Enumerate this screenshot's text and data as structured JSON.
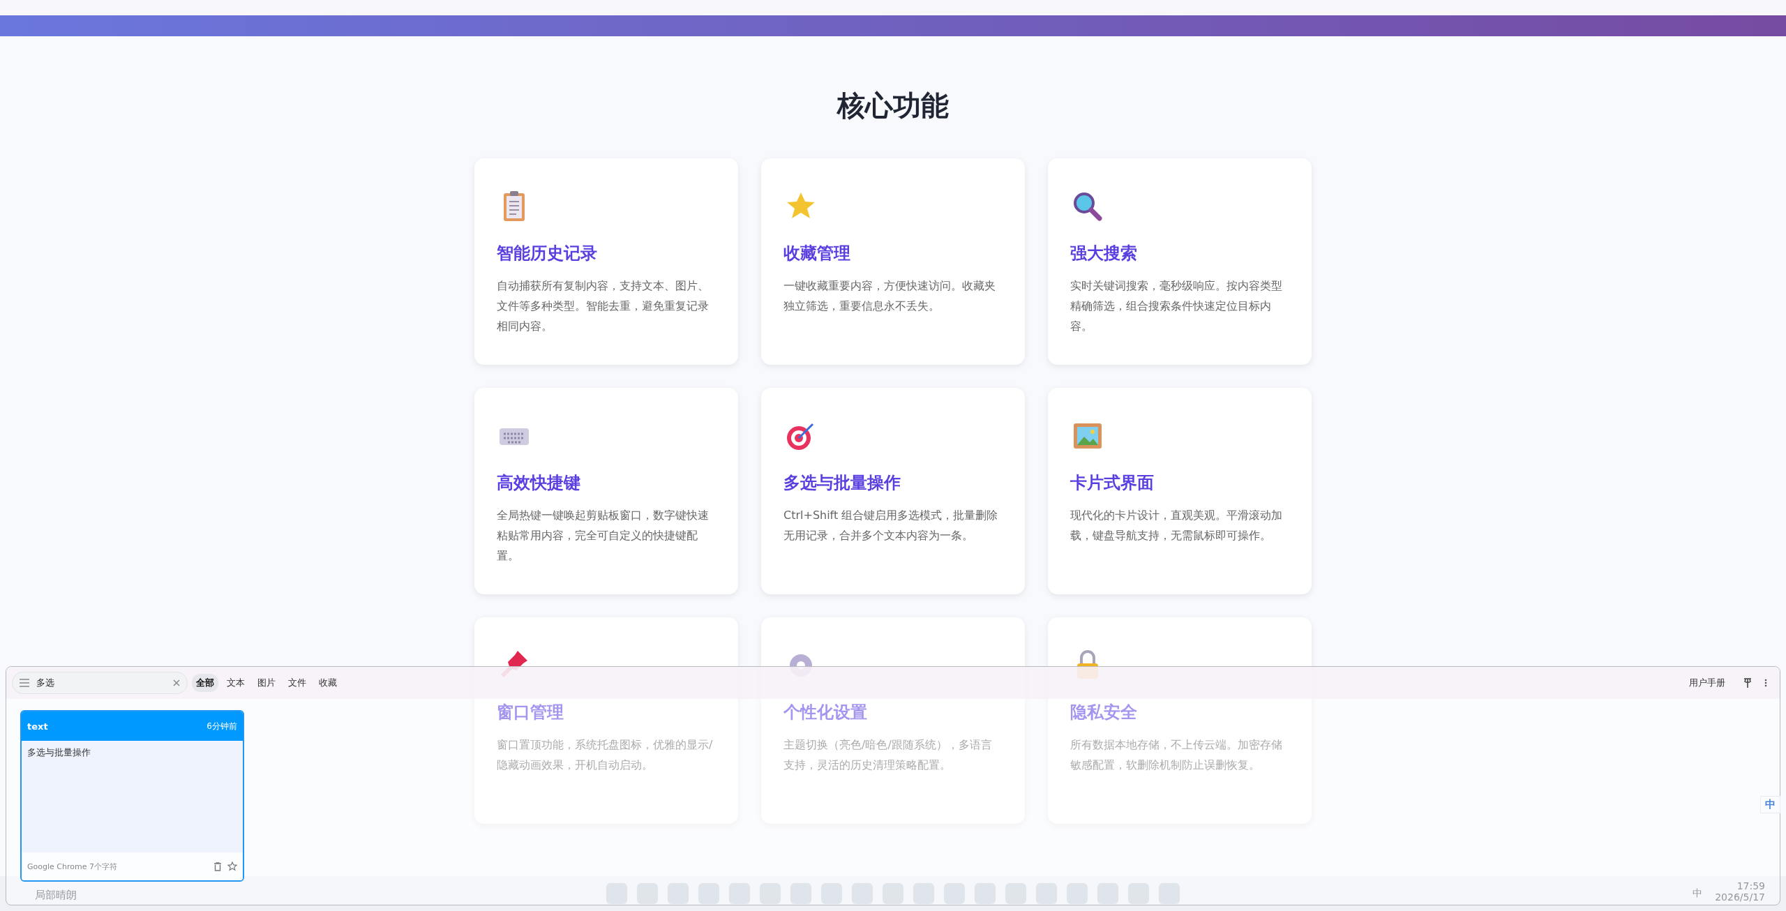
{
  "page": {
    "heading": "核心功能",
    "features": [
      {
        "title": "智能历史记录",
        "desc": "自动捕获所有复制内容，支持文本、图片、文件等多种类型。智能去重，避免重复记录相同内容。"
      },
      {
        "title": "收藏管理",
        "desc": "一键收藏重要内容，方便快速访问。收藏夹独立筛选，重要信息永不丢失。"
      },
      {
        "title": "强大搜索",
        "desc": "实时关键词搜索，毫秒级响应。按内容类型精确筛选，组合搜索条件快速定位目标内容。"
      },
      {
        "title": "高效快捷键",
        "desc": "全局热键一键唤起剪贴板窗口，数字键快速粘贴常用内容，完全可自定义的快捷键配置。"
      },
      {
        "title": "多选与批量操作",
        "desc": "Ctrl+Shift 组合键启用多选模式，批量删除无用记录，合并多个文本内容为一条。"
      },
      {
        "title": "卡片式界面",
        "desc": "现代化的卡片设计，直观美观。平滑滚动加载，键盘导航支持，无需鼠标即可操作。"
      },
      {
        "title": "窗口管理",
        "desc": "窗口置顶功能，系统托盘图标，优雅的显示/隐藏动画效果，开机自动启动。"
      },
      {
        "title": "个性化设置",
        "desc": "主题切换（亮色/暗色/跟随系统），多语言支持，灵活的历史清理策略配置。"
      },
      {
        "title": "隐私安全",
        "desc": "所有数据本地存储，不上传云端。加密存储敏感配置，软删除机制防止误删恢复。"
      }
    ]
  },
  "clipboard_window": {
    "search": {
      "value": "多选"
    },
    "filters": [
      {
        "label": "全部",
        "selected": true
      },
      {
        "label": "文本",
        "selected": false
      },
      {
        "label": "图片",
        "selected": false
      },
      {
        "label": "文件",
        "selected": false
      },
      {
        "label": "收藏",
        "selected": false
      }
    ],
    "manual_link": "用户手册",
    "items": [
      {
        "type": "text",
        "time": "6分钟前",
        "content": "多选与批量操作",
        "source": "Google Chrome 7个字符",
        "favorite": false
      }
    ]
  },
  "ime_bar": {
    "mode": "中"
  },
  "taskbar": {
    "weather": "局部晴朗",
    "tray_ime": "中",
    "time": "17:59",
    "date": "2026/5/17"
  }
}
